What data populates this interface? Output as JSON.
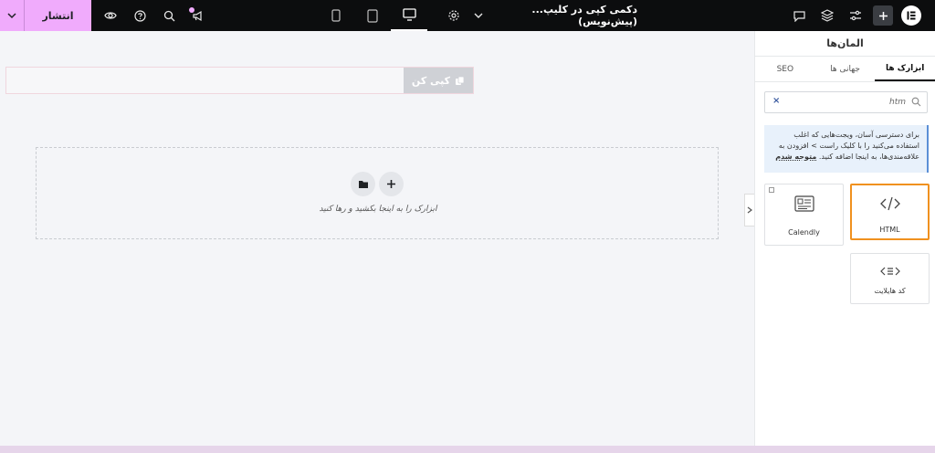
{
  "topbar": {
    "publish_label": "انتشار",
    "doc_title": "دکمی کپی در کلیپ... (پیش‌نویس)",
    "devices": [
      "mobile",
      "tablet",
      "desktop"
    ],
    "active_device": "desktop"
  },
  "canvas": {
    "copy_button_label": "کپی کن",
    "drop_text": "ابزارک را به اینجا بکشید و رها کنید"
  },
  "panel": {
    "title": "المان‌ها",
    "tabs": [
      "ابزارک ها",
      "جهانی ها",
      "SEO"
    ],
    "active_tab": "ابزارک ها",
    "search_value": "htm",
    "notice_text": "برای دسترسی آسان، ویجت‌هایی که اغلب استفاده می‌کنید را با کلیک راست > افزودن به علاقه‌مندی‌ها، به اینجا اضافه کنید.",
    "notice_link": "متوجه شدم",
    "widgets": [
      {
        "label": "HTML",
        "icon": "code-icon"
      },
      {
        "label": "Calendly",
        "icon": "calendly-icon"
      },
      {
        "label": "کد هایلایت",
        "icon": "code-highlight-icon"
      }
    ]
  },
  "colors": {
    "accent": "#f0abfc",
    "highlight": "#f0911f",
    "topbar": "#0c0d0e"
  }
}
